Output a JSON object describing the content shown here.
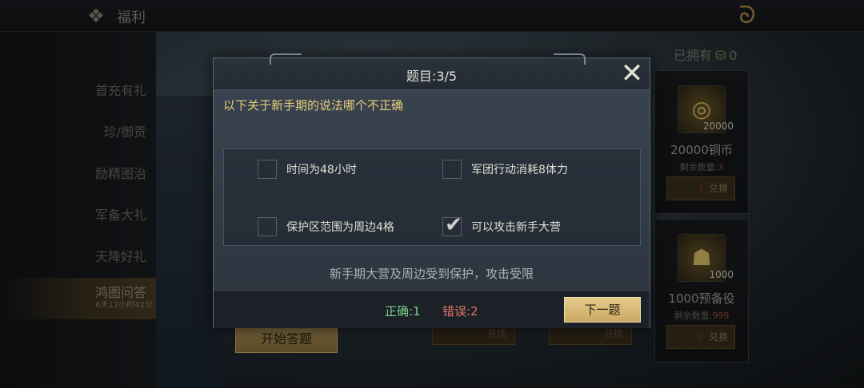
{
  "header": {
    "title": "福利"
  },
  "sidebar": {
    "items": [
      {
        "label": "首充有礼"
      },
      {
        "label": "珍/御贡"
      },
      {
        "label": "励精图治"
      },
      {
        "label": "军备大礼"
      },
      {
        "label": "天降好礼"
      },
      {
        "label": "鸿图问答",
        "sub": "6天12小时42分"
      }
    ]
  },
  "owned": {
    "label": "已拥有",
    "count": "0"
  },
  "cards": [
    {
      "qty": "20000",
      "name": "20000铜币",
      "remain_label": "剩余数量:",
      "remain": "3",
      "cost": "1",
      "btn": "兑换"
    },
    {
      "qty": "1000",
      "name": "1000预备役",
      "remain_label": "剩余数量:",
      "remain": "999",
      "cost": "2",
      "btn": "兑换"
    }
  ],
  "bottom_buttons": [
    {
      "label": "兑换"
    },
    {
      "label": "兑换"
    }
  ],
  "start_button": "开始答题",
  "dialog": {
    "title": "题目:3/5",
    "question": "以下关于新手期的说法哪个不正确",
    "options": [
      {
        "label": "时间为48小时",
        "checked": false
      },
      {
        "label": "军团行动消耗8体力",
        "checked": false
      },
      {
        "label": "保护区范围为周边4格",
        "checked": false
      },
      {
        "label": "可以攻击新手大营",
        "checked": true
      }
    ],
    "hint": "新手期大营及周边受到保护，攻击受限",
    "correct": "正确:1",
    "wrong": "错误:2",
    "next_button": "下一题"
  },
  "icons": {
    "close": "close-x-icon",
    "check": "checkmark-icon",
    "coin": "coin-icon",
    "helmet": "helmet-icon",
    "logo": "dragon-logo-icon"
  },
  "colors": {
    "accent": "#e6cc8e",
    "correct": "#7dcf8a",
    "wrong": "#e07568",
    "question": "#e8cd7c"
  }
}
